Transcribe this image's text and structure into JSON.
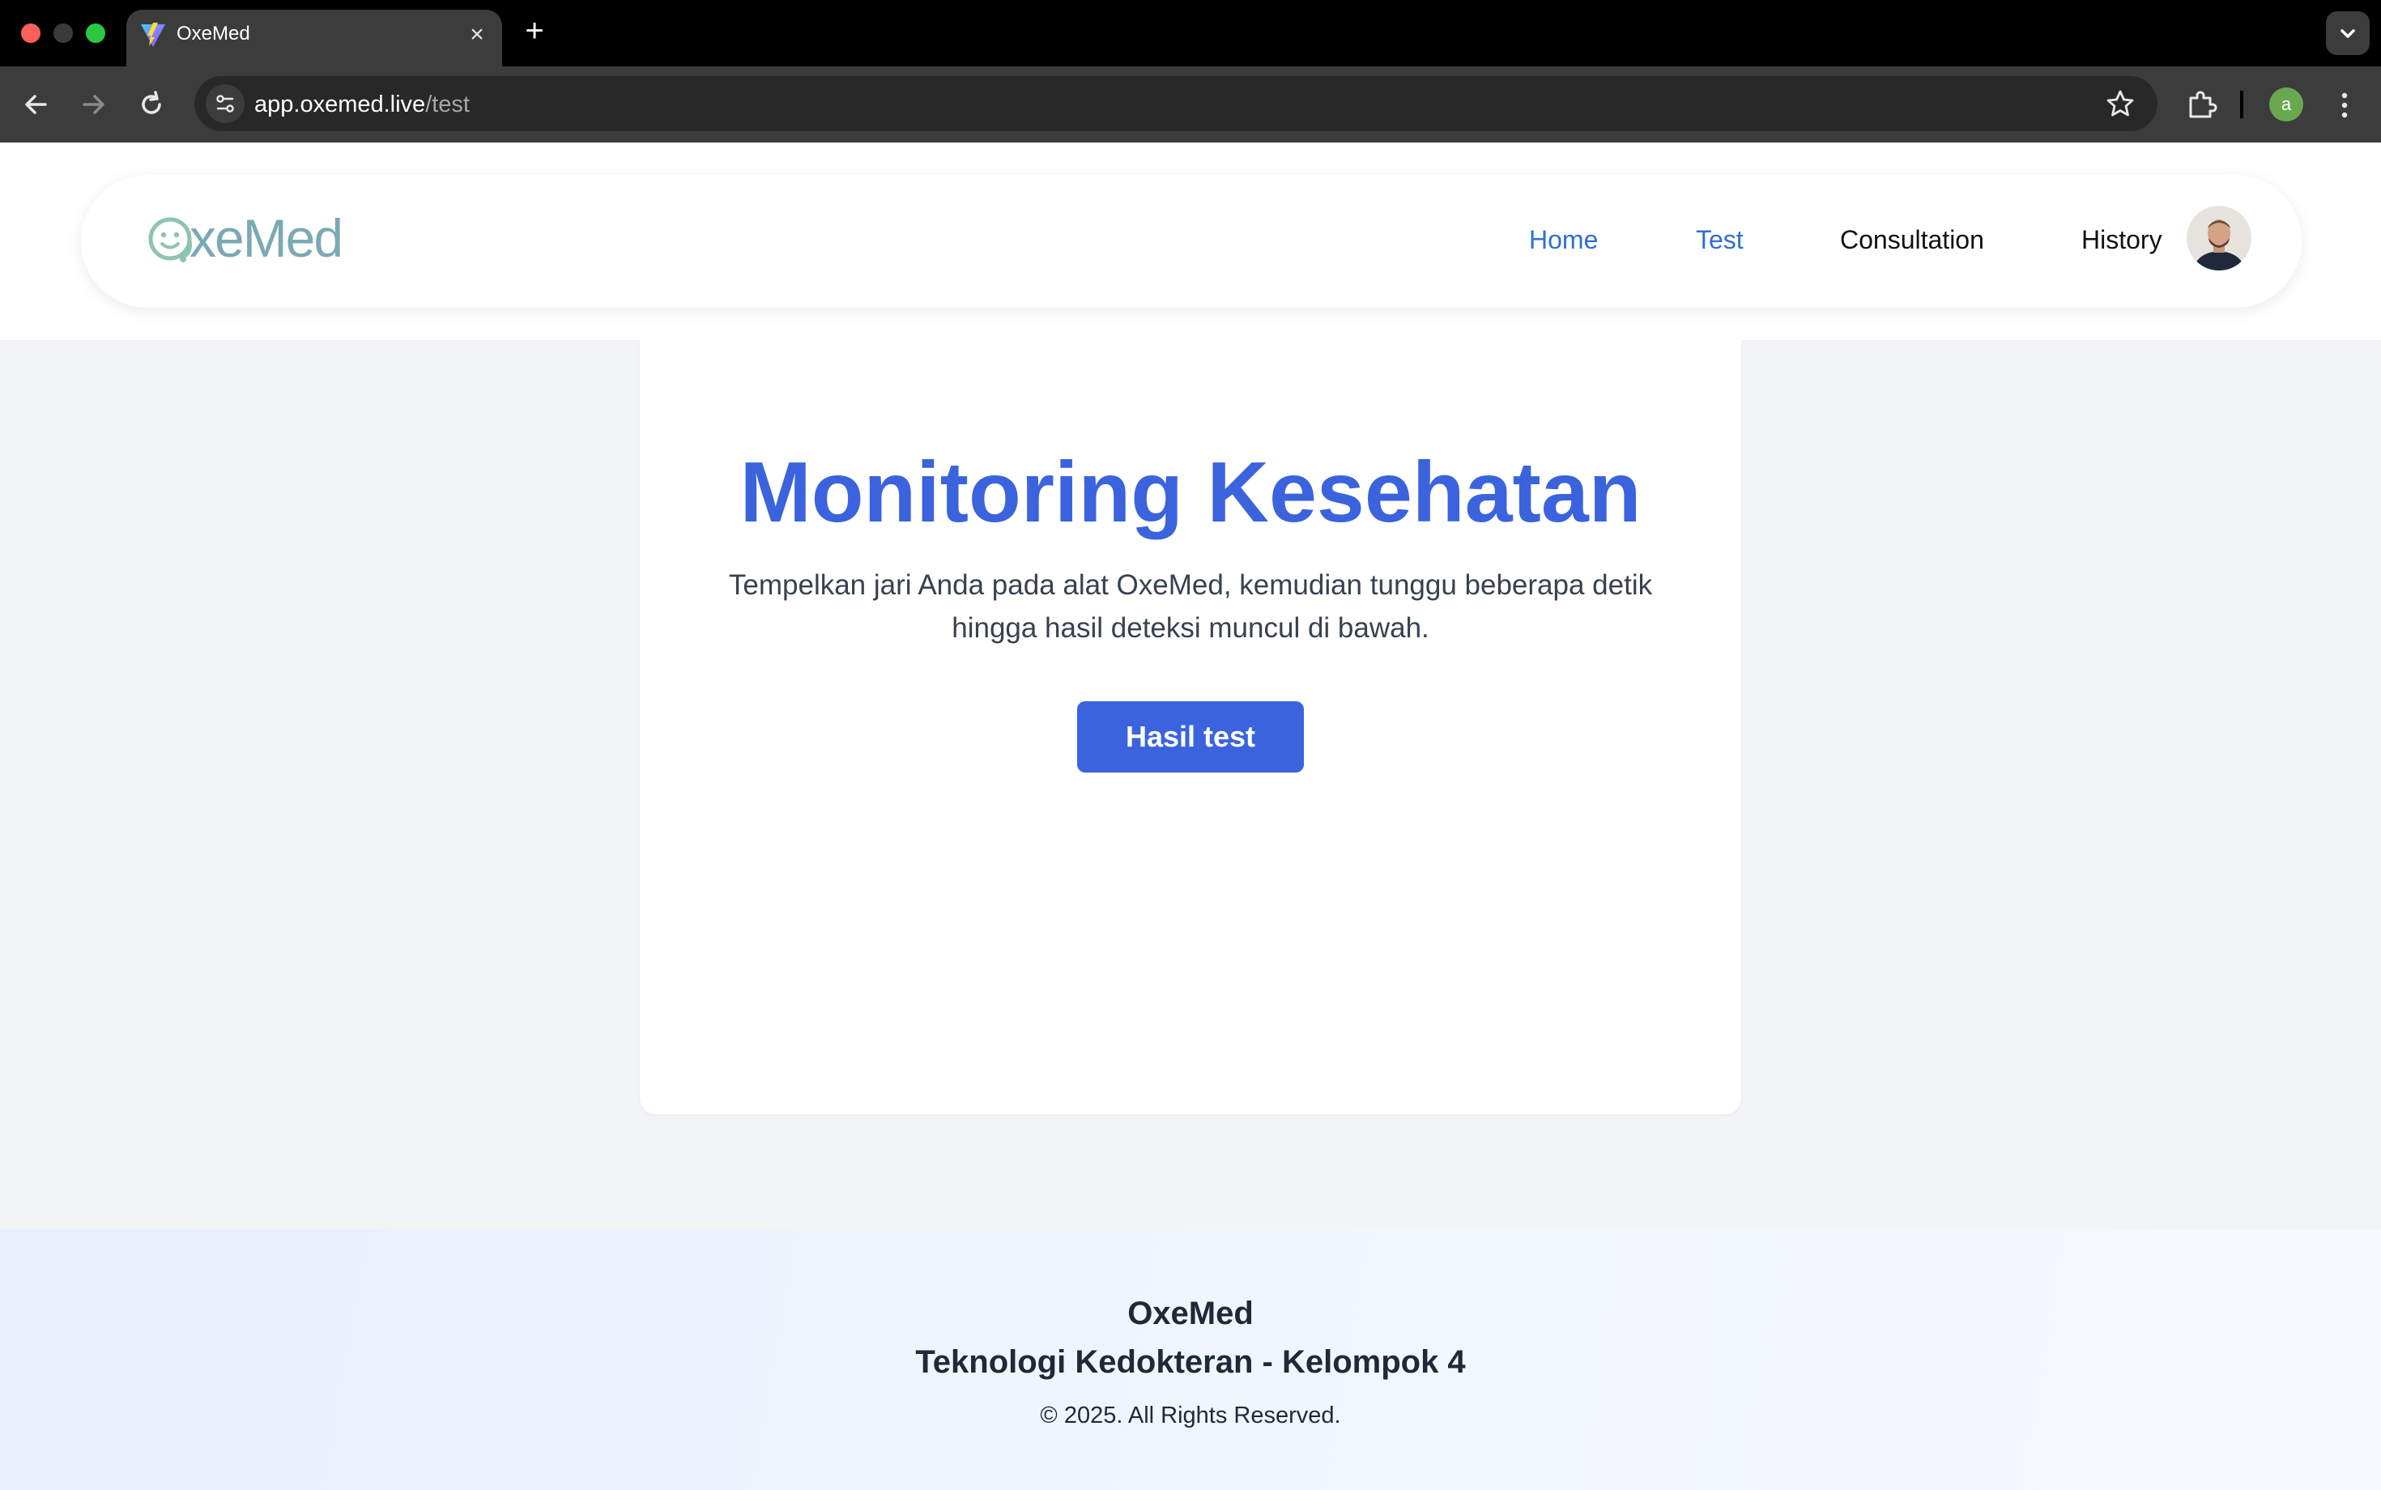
{
  "browser": {
    "tab_title": "OxeMed",
    "url_host": "app.oxemed.live",
    "url_path": "/test",
    "profile_initial": "a",
    "icons": [
      "back-icon",
      "forward-icon",
      "reload-icon",
      "site-info-icon",
      "star-icon",
      "extensions-icon",
      "more-menu-icon",
      "new-tab-icon",
      "close-icon",
      "chevron-down-icon"
    ]
  },
  "nav": {
    "brand": "OxeMed",
    "links": [
      {
        "label": "Home",
        "active": true
      },
      {
        "label": "Test",
        "active": true
      },
      {
        "label": "Consultation",
        "active": false
      },
      {
        "label": "History",
        "active": false
      }
    ]
  },
  "main": {
    "title": "Monitoring Kesehatan",
    "subtitle_line1": "Tempelkan jari Anda pada alat OxeMed, kemudian tunggu beberapa detik",
    "subtitle_line2": "hingga hasil deteksi muncul di bawah.",
    "button_label": "Hasil test"
  },
  "footer": {
    "brand": "OxeMed",
    "subtitle": "Teknologi Kedokteran - Kelompok 4",
    "copyright": "© 2025. All Rights Reserved."
  },
  "colors": {
    "accent": "#3b63dd",
    "nav_active": "#2f6fd6",
    "logo": "#7fb6a8"
  }
}
